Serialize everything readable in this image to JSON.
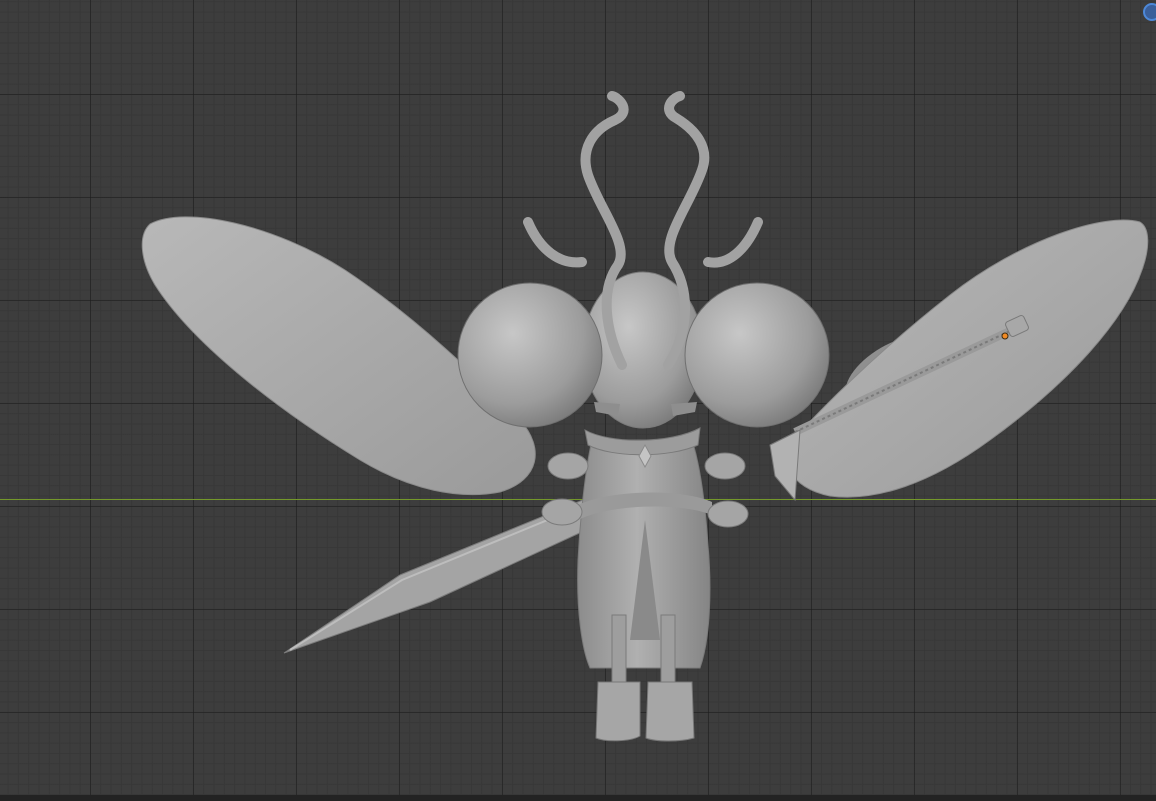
{
  "viewport": {
    "background_color": "#3d3d3d",
    "grid_color": "#373737",
    "x_axis_color": "#74982b",
    "model_color": "#a8a8a8",
    "model_shadow_color": "#7e7e7e",
    "selection_color": "#f08a24",
    "gizmo_color": "#4d88d8"
  },
  "icons": {
    "navigation_gizmo": "navigation-gizmo-icon"
  }
}
